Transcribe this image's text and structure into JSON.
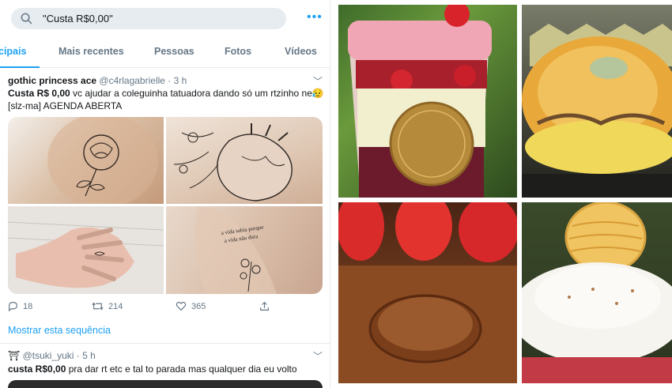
{
  "search": {
    "query": "\"Custa R$0,00\""
  },
  "tabs": [
    {
      "label": "cipais"
    },
    {
      "label": "Mais recentes"
    },
    {
      "label": "Pessoas"
    },
    {
      "label": "Fotos"
    },
    {
      "label": "Vídeos"
    }
  ],
  "tweet1": {
    "name": "gothic princess ace",
    "handle": "@c4rlagabrielle · 3 h",
    "text_bold": "Custa R$ 0,00",
    "text_rest": " vc ajudar a coleguinha tatuadora dando só um rtzinho ne",
    "emoji": "😥",
    "text_line2": "[slz-ma] AGENDA ABERTA",
    "replies": "18",
    "retweets": "214",
    "likes": "365",
    "show_thread": "Mostrar esta sequência",
    "tattoo_text": "a vida sabia porque a vida não dura"
  },
  "tweet2": {
    "handle": "@tsuki_yuki · 5 h",
    "text_bold": "custa R$0,00",
    "text_rest": " pra dar rt etc e tal to parada mas qualquer dia eu volto"
  },
  "colors": {
    "accent": "#1da1f2",
    "muted": "#657786",
    "search_bg": "#e6ecf0"
  }
}
